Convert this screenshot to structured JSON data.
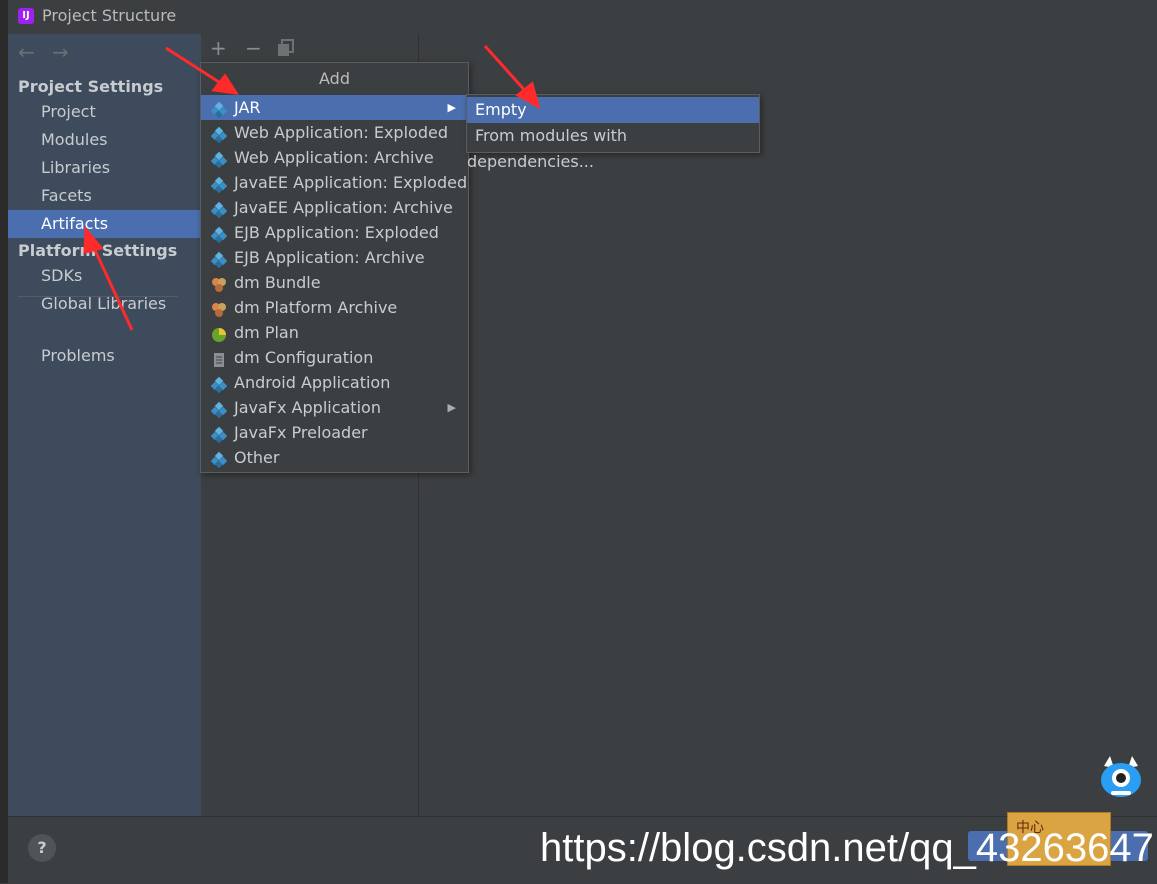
{
  "window": {
    "title": "Project Structure"
  },
  "nav": {
    "back_icon": "arrow-left-icon",
    "forward_icon": "arrow-right-icon",
    "project_settings_header": "Project Settings",
    "project_items": [
      "Project",
      "Modules",
      "Libraries",
      "Facets",
      "Artifacts"
    ],
    "platform_settings_header": "Platform Settings",
    "platform_items": [
      "SDKs",
      "Global Libraries"
    ],
    "problems": "Problems",
    "selected": "Artifacts"
  },
  "toolbar": {
    "add": "+",
    "remove": "−",
    "copy_icon": "copy-icon"
  },
  "add_menu": {
    "title": "Add",
    "items": [
      {
        "label": "JAR",
        "submenu": true,
        "selected": true
      },
      {
        "label": "Web Application: Exploded"
      },
      {
        "label": "Web Application: Archive"
      },
      {
        "label": "JavaEE Application: Exploded"
      },
      {
        "label": "JavaEE Application: Archive"
      },
      {
        "label": "EJB Application: Exploded"
      },
      {
        "label": "EJB Application: Archive"
      },
      {
        "label": "dm Bundle"
      },
      {
        "label": "dm Platform Archive"
      },
      {
        "label": "dm Plan"
      },
      {
        "label": "dm Configuration"
      },
      {
        "label": "Android Application"
      },
      {
        "label": "JavaFx Application",
        "submenu": true
      },
      {
        "label": "JavaFx Preloader"
      },
      {
        "label": "Other"
      }
    ]
  },
  "jar_submenu": {
    "items": [
      "Empty",
      "From modules with dependencies..."
    ],
    "selected": "Empty"
  },
  "bottom": {
    "help": "?"
  },
  "watermark": {
    "text": "https://blog.csdn.net/qq_43263647"
  },
  "sticker": {
    "text": "中心"
  },
  "colors": {
    "selection": "#4b6eaf",
    "background": "#3c3f41",
    "left_pane": "#3d4b5c",
    "arrow": "#ff2a2a"
  }
}
